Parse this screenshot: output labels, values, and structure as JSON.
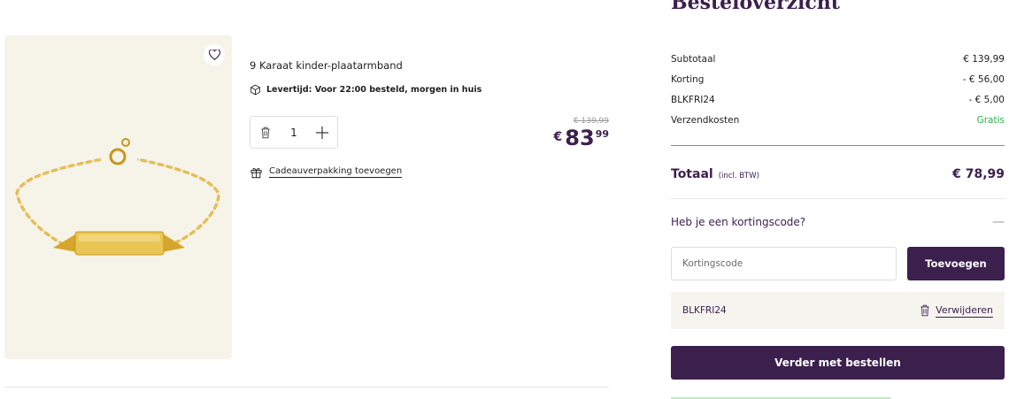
{
  "product": {
    "name": "9 Karaat kinder-plaatarmband",
    "delivery": "Levertijd: Voor 22:00 besteld, morgen in huis",
    "quantity": "1",
    "old_price": "€ 139,99",
    "price_currency": "€",
    "price_main": "83",
    "price_cents": "99",
    "gift_label": "Cadeauverpakking toevoegen"
  },
  "summary": {
    "title": "Besteloverzicht",
    "rows": [
      {
        "label": "Subtotaal",
        "value": "€ 139,99"
      },
      {
        "label": "Korting",
        "value": "- € 56,00"
      },
      {
        "label": "BLKFRI24",
        "value": "- € 5,00"
      },
      {
        "label": "Verzendkosten",
        "value": "Gratis"
      }
    ],
    "total_label": "Totaal",
    "total_incl": "(incl. BTW)",
    "total_value": "€ 78,99",
    "discount_question": "Heb je een kortingscode?",
    "discount_toggle": "—",
    "code_placeholder": "Kortingscode",
    "apply_label": "Toevoegen",
    "applied_code": "BLKFRI24",
    "remove_label": "Verwijderen",
    "checkout_label": "Verder met bestellen"
  },
  "colors": {
    "brand": "#3b1f4d",
    "success": "#2fb24c",
    "image_bg": "#f6f3e8"
  },
  "icons": [
    "heart-icon",
    "package-icon",
    "trash-icon",
    "plus-icon",
    "gift-icon"
  ]
}
